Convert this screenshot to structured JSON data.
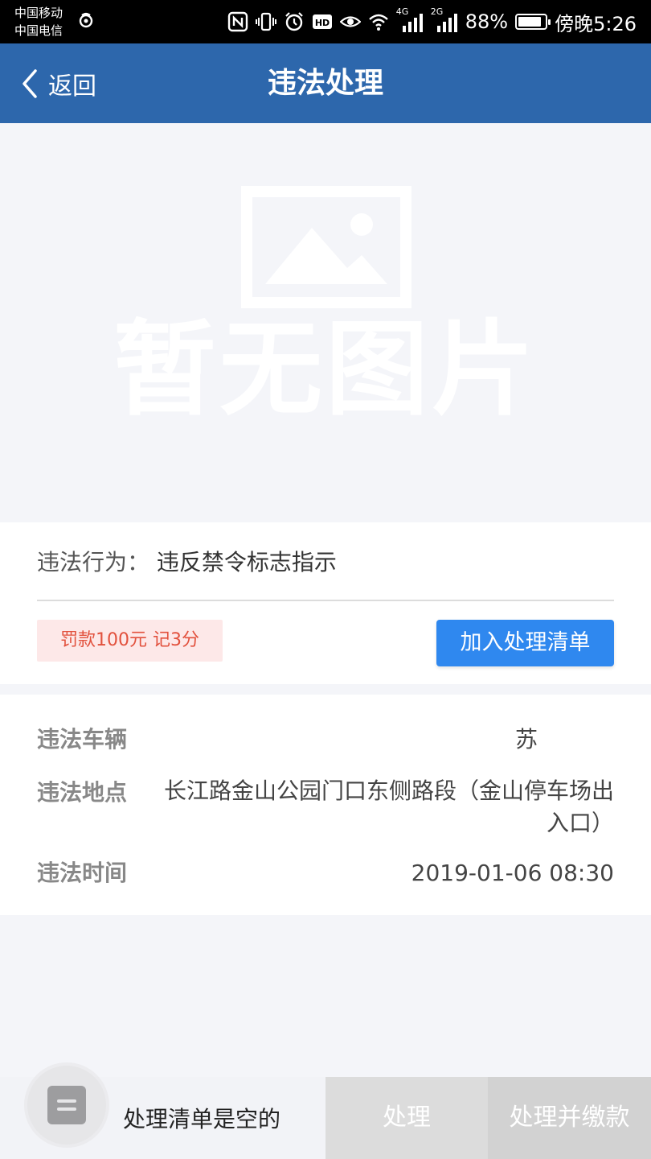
{
  "status_bar": {
    "carrier_1": "中国移动",
    "carrier_2": "中国电信",
    "network_1": "4G",
    "network_2": "2G",
    "battery_percent": "88%",
    "battery_level": 0.88,
    "time": "傍晚5:26",
    "icons": [
      "nfc-icon",
      "vibrate-icon",
      "alarm-icon",
      "hd-icon",
      "eye-comfort-icon",
      "wifi-icon",
      "signal-icon",
      "battery-icon"
    ]
  },
  "nav": {
    "back_label": "返回",
    "title": "违法处理"
  },
  "image_area": {
    "placeholder_text": "暂无图片"
  },
  "violation": {
    "behavior_label": "违法行为：",
    "behavior_value": "违反禁令标志指示",
    "penalty": "罚款100元 记3分",
    "add_button": "加入处理清单"
  },
  "details": {
    "vehicle_label": "违法车辆",
    "vehicle_value": "苏",
    "place_label": "违法地点",
    "place_value": "长江路金山公园门口东侧路段（金山停车场出入口）",
    "time_label": "违法时间",
    "time_value": "2019-01-06 08:30"
  },
  "bottom_bar": {
    "cart_text": "处理清单是空的",
    "process_button": "处理",
    "process_pay_button": "处理并缴款"
  },
  "colors": {
    "nav_bg": "#2d67ac",
    "page_bg": "#f4f5f9",
    "primary_button": "#2f88ef",
    "penalty_text": "#e2513d",
    "penalty_bg": "#fde8e8",
    "disabled_button": "#dcdcdc"
  }
}
